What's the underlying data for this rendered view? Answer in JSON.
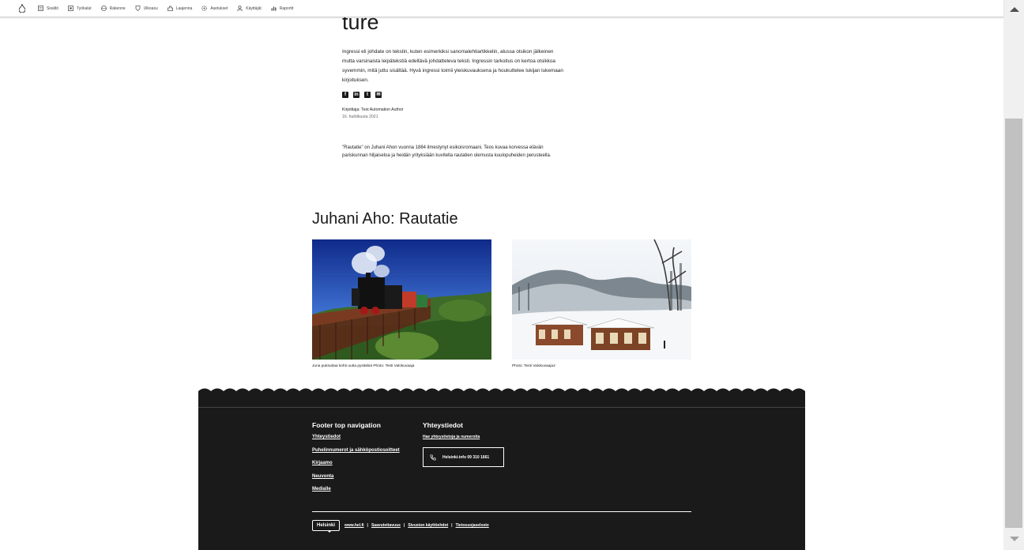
{
  "toolbar": {
    "items": [
      {
        "label": "Sisältö",
        "icon": "content-icon"
      },
      {
        "label": "Työkalut",
        "icon": "tools-icon"
      },
      {
        "label": "Rakenne",
        "icon": "structure-icon"
      },
      {
        "label": "Ulkoasu",
        "icon": "appearance-icon"
      },
      {
        "label": "Laajenna",
        "icon": "extend-icon"
      },
      {
        "label": "Asetukset",
        "icon": "settings-icon"
      },
      {
        "label": "Käyttäjät",
        "icon": "users-icon"
      },
      {
        "label": "Raportit",
        "icon": "reports-icon"
      }
    ]
  },
  "article": {
    "heading_partial": "ture",
    "lead": "Ingressi eli johdate on tekstin, kuten esimerkiksi sanomalehtiartikkelin, alussa otsikon jälkeinen mutta varsinaista leipätekstiä edeltävä johdatteleva teksti. Ingressin tarkoitus on kertoa otsikkoa syvemmin, mitä juttu sisältää. Hyvä ingressi toimii yleiskuvauksena ja houkuttelee lukijan lukemaan kirjoituksen.",
    "author": "Kirjoittaja: Test Automation Author",
    "date": "16. huhtikuuta 2021",
    "body": "\"Rautatie\" on Juhani Ahon vuonna 1884 ilmestynyt esikoisromaani. Teos kuvaa korvessa elävän pariskunnan hiljaiseloa ja heidän yrityksiään kuvitella rautatien olemusta kuulopuheiden perusteella."
  },
  "gallery": {
    "title": "Juhani Aho: Rautatie",
    "captions": [
      "Juna puksuttaa kohti uutta pysäkkiä Photo: Testi Valokuvaaja",
      "Photo: Testi Valokuvaaja2"
    ]
  },
  "footer": {
    "nav_title": "Footer top navigation",
    "nav_links": [
      "Yhteystiedot",
      "Puhelinnumerot ja sähköpostiosoitteet",
      "Kirjaamo",
      "Neuvonta",
      "Medialle"
    ],
    "contact_title": "Yhteystiedot",
    "contact_link": "Hae yhteystietoja ja numeroita",
    "phone_button": "Helsinki-info 09 310 1661",
    "logo": "Helsinki",
    "bottom_links": [
      "www.hel.fi",
      "Saavutettavuus",
      "Sivuston käyttöehdot",
      "Tietosuojaseloste"
    ]
  },
  "colors": {
    "footer_bg": "#1a1a1a",
    "text": "#1a1a1a"
  }
}
